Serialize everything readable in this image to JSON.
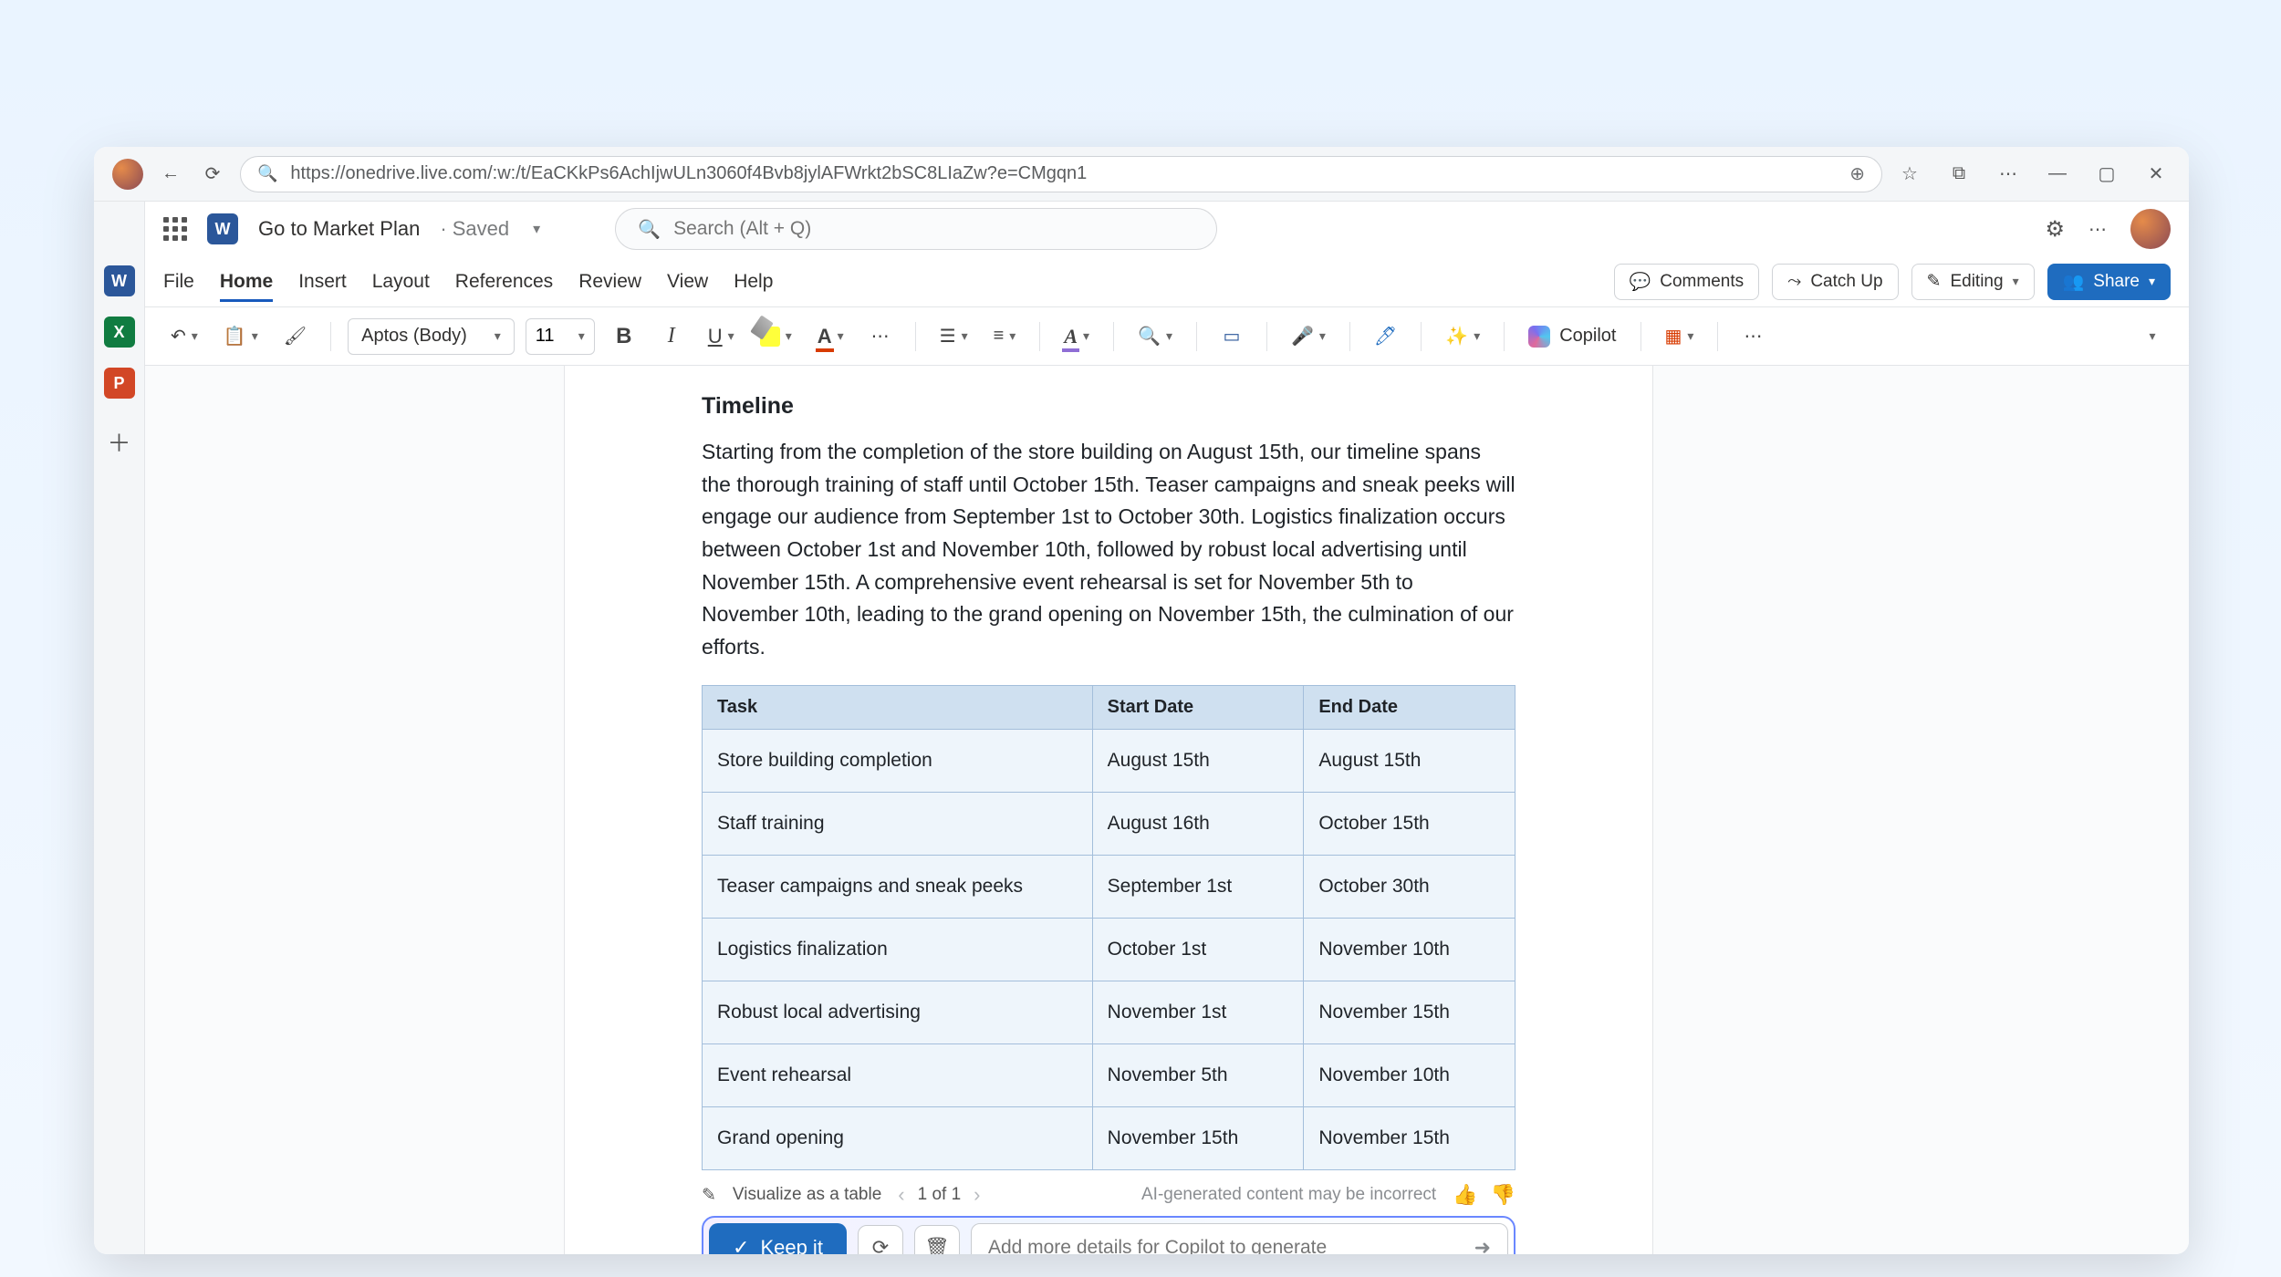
{
  "browser": {
    "url": "https://onedrive.live.com/:w:/t/EaCKkPs6AchIjwULn3060f4Bvb8jylAFWrkt2bSC8LIaZw?e=CMgqn1"
  },
  "title": {
    "doc_name": "Go to Market Plan",
    "saved_label": "· Saved",
    "search_placeholder": "Search (Alt + Q)"
  },
  "menus": [
    "File",
    "Home",
    "Insert",
    "Layout",
    "References",
    "Review",
    "View",
    "Help"
  ],
  "active_menu": "Home",
  "actions": {
    "comments": "Comments",
    "catch_up": "Catch Up",
    "editing": "Editing",
    "share": "Share"
  },
  "ribbon": {
    "font_name": "Aptos (Body)",
    "font_size": "11",
    "copilot_label": "Copilot"
  },
  "document": {
    "heading": "Timeline",
    "paragraph": "Starting from the completion of the store building on August 15th, our timeline spans the thorough training of staff until October 15th. Teaser campaigns and sneak peeks will engage our audience from September 1st to October 30th. Logistics finalization occurs between October 1st and November 10th, followed by robust local advertising until November 15th. A comprehensive event rehearsal is set for November 5th to November 10th, leading to the grand opening on November 15th, the culmination of our efforts.",
    "headers": {
      "task": "Task",
      "start": "Start Date",
      "end": "End Date"
    },
    "rows": [
      {
        "task": "Store building completion",
        "start": "August 15th",
        "end": "August 15th"
      },
      {
        "task": "Staff training",
        "start": "August 16th",
        "end": "October 15th"
      },
      {
        "task": "Teaser campaigns and sneak peeks",
        "start": "September 1st",
        "end": "October 30th"
      },
      {
        "task": "Logistics finalization",
        "start": "October 1st",
        "end": "November 10th"
      },
      {
        "task": "Robust local advertising",
        "start": "November 1st",
        "end": "November 15th"
      },
      {
        "task": "Event rehearsal",
        "start": "November 5th",
        "end": "November 10th"
      },
      {
        "task": "Grand opening",
        "start": "November 15th",
        "end": "November 15th"
      }
    ]
  },
  "copilot": {
    "visualize_label": "Visualize as a table",
    "page_indicator": "1 of 1",
    "disclaimer": "AI-generated content may be incorrect",
    "keep_label": "Keep it",
    "input_placeholder": "Add more details for Copilot to generate"
  }
}
